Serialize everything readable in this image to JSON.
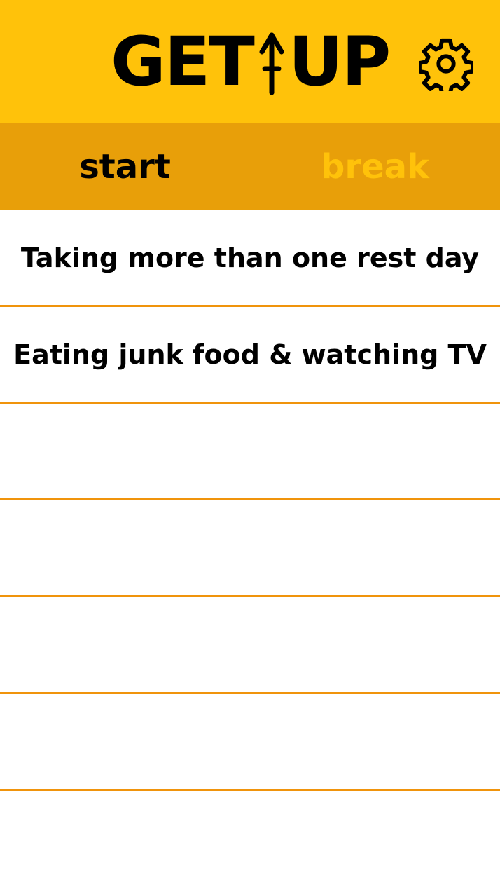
{
  "header": {
    "logo_left": "GET",
    "logo_right": "UP",
    "settings_icon": "gear-icon",
    "background_color": "#FFC20A"
  },
  "tabs": {
    "items": [
      {
        "label": "start",
        "active": true
      },
      {
        "label": "break",
        "active": false
      }
    ],
    "background_color": "#E89F09",
    "active_color": "#000000",
    "inactive_color": "#FFC20A"
  },
  "list": {
    "items": [
      {
        "text": "Taking more than one rest day"
      },
      {
        "text": "Eating junk food & watching TV"
      },
      {
        "text": ""
      },
      {
        "text": ""
      },
      {
        "text": ""
      },
      {
        "text": ""
      }
    ],
    "divider_color": "#F0940C"
  }
}
